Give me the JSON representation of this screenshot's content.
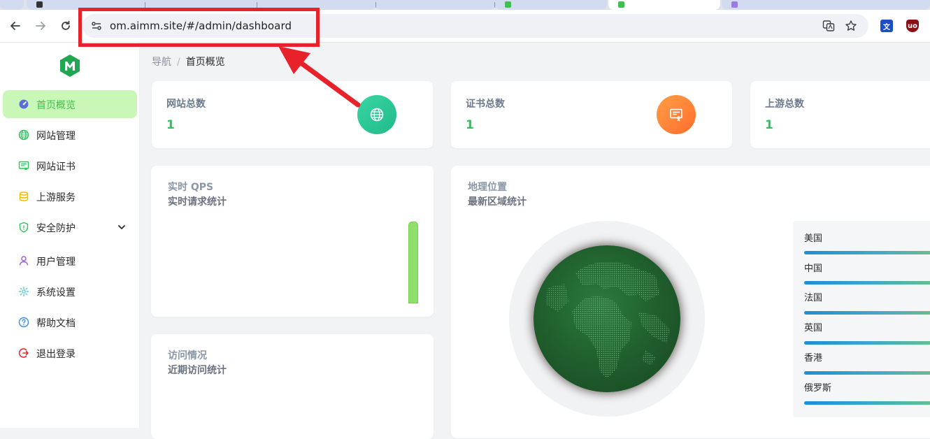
{
  "browser": {
    "url": "om.aimm.site/#/admin/dashboard"
  },
  "breadcrumb": {
    "root": "导航",
    "separator": "/",
    "current": "首页概览"
  },
  "sidebar": {
    "items": [
      {
        "label": "首页概览",
        "icon": "dashboard-icon",
        "active": true
      },
      {
        "label": "网站管理",
        "icon": "globe-icon"
      },
      {
        "label": "网站证书",
        "icon": "certificate-icon"
      },
      {
        "label": "上游服务",
        "icon": "database-icon"
      },
      {
        "label": "安全防护",
        "icon": "shield-icon",
        "expandable": true
      },
      {
        "label": "用户管理",
        "icon": "user-icon"
      },
      {
        "label": "系统设置",
        "icon": "gear-icon"
      },
      {
        "label": "帮助文档",
        "icon": "help-icon"
      },
      {
        "label": "退出登录",
        "icon": "logout-icon"
      }
    ]
  },
  "stats": [
    {
      "title": "网站总数",
      "value": "1",
      "icon": "globe-icon",
      "color": "#2ec98f"
    },
    {
      "title": "证书总数",
      "value": "1",
      "icon": "certificate-icon",
      "color": "#ff7d3a"
    },
    {
      "title": "上游总数",
      "value": "1"
    }
  ],
  "qps_panel": {
    "title": "实时 QPS",
    "subtitle": "实时请求统计"
  },
  "visit_panel": {
    "title": "访问情况",
    "subtitle": "近期访问统计"
  },
  "geo_panel": {
    "title": "地理位置",
    "subtitle": "最新区域统计",
    "regions": [
      "美国",
      "中国",
      "法国",
      "英国",
      "香港",
      "俄罗斯"
    ]
  },
  "colors": {
    "accent": "#3fbf4f",
    "active_bg": "#c9f7b7",
    "annotation": "#e8222b"
  }
}
